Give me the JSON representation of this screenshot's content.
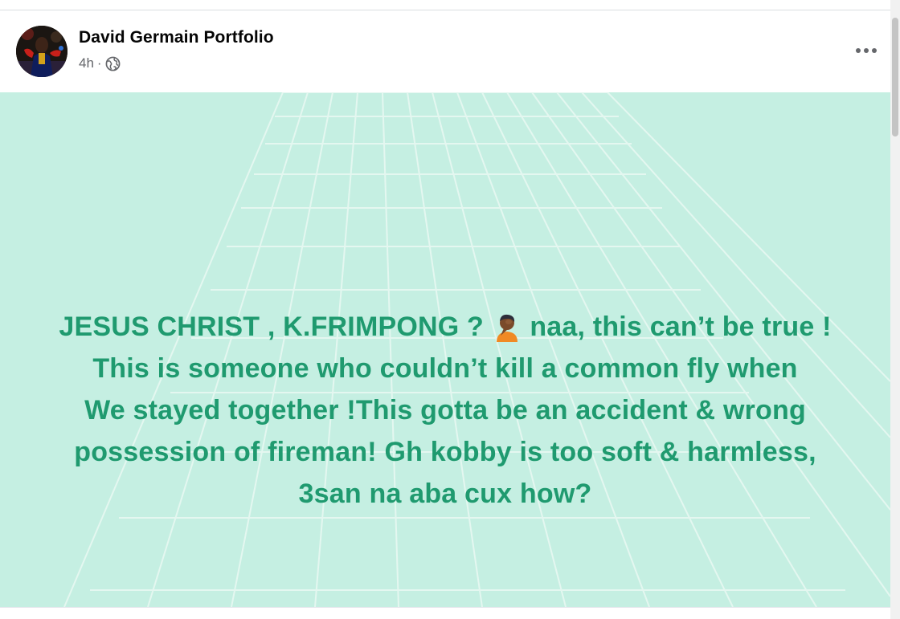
{
  "post": {
    "author": "David Germain Portfolio",
    "time": "4h",
    "separator": "·",
    "privacy_icon": "globe-icon",
    "more_icon": "more-horizontal-icon",
    "background_color": "#c5efe2",
    "text_color": "#1f9a6f",
    "text_parts": {
      "part1": "JESUS CHRIST , K.FRIMPONG ?",
      "emoji": "face-palm-person-emoji",
      "part2": " naa, this can’t be true !",
      "line2": "This is someone who couldn’t kill a common fly when",
      "line3": "We stayed together !This gotta be an accident & wrong",
      "line4": "possession of fireman! Gh kobby is too soft & harmless,",
      "line5": "3san na aba cux how?"
    }
  }
}
